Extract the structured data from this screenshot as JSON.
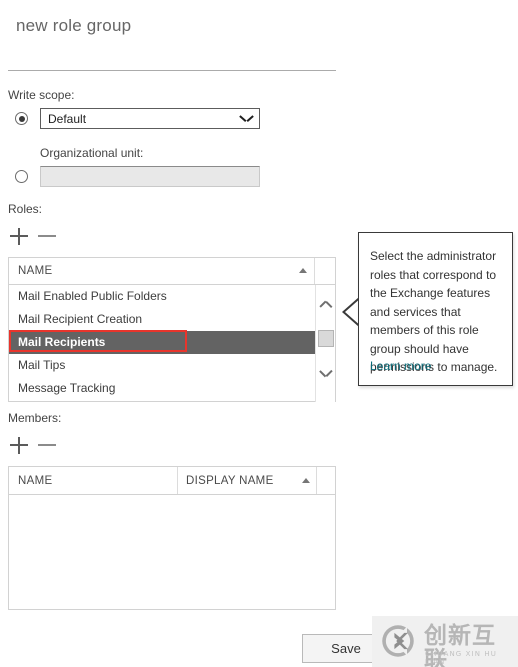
{
  "page": {
    "title": "new role group"
  },
  "write_scope": {
    "label": "Write scope:",
    "selected_option": "Default",
    "options": [
      "Default",
      "Organizational unit"
    ],
    "ou_label": "Organizational unit:",
    "ou_value": "",
    "ou_placeholder": ""
  },
  "roles": {
    "label": "Roles:",
    "add_icon": "plus-icon",
    "remove_icon": "minus-icon",
    "column_header": "NAME",
    "sort_direction": "ascending",
    "items": [
      {
        "name": "Mail Enabled Public Folders",
        "selected": false
      },
      {
        "name": "Mail Recipient Creation",
        "selected": false
      },
      {
        "name": "Mail Recipients",
        "selected": true
      },
      {
        "name": "Mail Tips",
        "selected": false
      },
      {
        "name": "Message Tracking",
        "selected": false
      }
    ],
    "scrollbar": {
      "up_icon": "chevron-up-icon",
      "down_icon": "chevron-down-icon"
    }
  },
  "callout": {
    "body": "Select the administrator roles that correspond to the Exchange features and services that members of this role group should have permissions to manage.",
    "link_label": "Learn more",
    "link_color": "#0a6b78",
    "border_color": "#3a3a3a"
  },
  "annotation": {
    "color": "#e8352c",
    "target": "Mail Recipients"
  },
  "members": {
    "label": "Members:",
    "add_icon": "plus-icon",
    "remove_icon": "minus-icon",
    "columns": [
      "NAME",
      "DISPLAY NAME"
    ],
    "sort_direction": "ascending",
    "rows": []
  },
  "footer": {
    "save_label": "Save"
  },
  "watermark": {
    "logo_icon": "cx-logo-icon",
    "chinese": "创新互联",
    "pinyin": "CHUANG XIN HU LIAN"
  }
}
